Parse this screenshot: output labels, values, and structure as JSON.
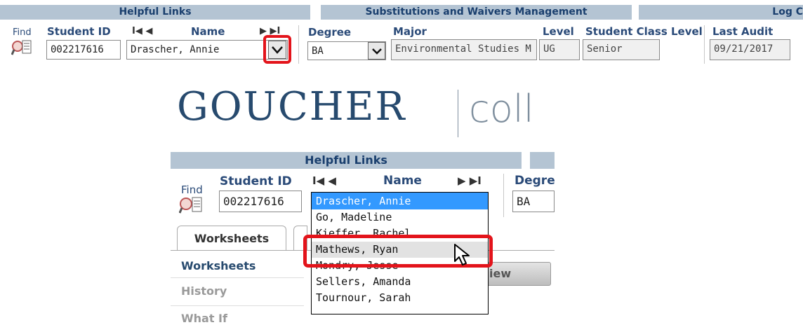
{
  "top": {
    "bands": [
      "Helpful Links",
      "Substitutions and Waivers Management",
      "Log C"
    ],
    "find_label": "Find",
    "labels": {
      "student_id": "Student ID",
      "name": "Name",
      "degree": "Degree",
      "major": "Major",
      "level": "Level",
      "class_level": "Student Class Level",
      "last_audit": "Last Audit"
    },
    "values": {
      "student_id": "002217616",
      "name": "Drascher, Annie",
      "degree": "BA",
      "major": "Environmental Studies M",
      "level": "UG",
      "class_level": "Senior",
      "last_audit": "09/21/2017"
    },
    "nav": {
      "first": "I◀ ◀",
      "next": "▶ ▶I"
    }
  },
  "logo": {
    "name": "GOUCHER",
    "suffix": "coll"
  },
  "zoom": {
    "band": "Helpful Links",
    "find_label": "Find",
    "labels": {
      "student_id": "Student ID",
      "name": "Name",
      "degree": "Degre"
    },
    "values": {
      "student_id": "002217616",
      "degree": "BA"
    },
    "nav": {
      "first": "I◀ ◀",
      "next": "▶ ▶I"
    },
    "tabs": [
      "Worksheets"
    ],
    "sidebar": [
      "Worksheets",
      "History",
      "What If"
    ],
    "view_button": "iew",
    "dropdown": {
      "options": [
        "Drascher, Annie",
        "Go, Madeline",
        "Kieffer, Rachel",
        "Mathews, Ryan",
        "Mondry, Jesse",
        "Sellers, Amanda",
        "Tournour, Sarah"
      ],
      "selected_index": 0,
      "hover_index": 3
    }
  },
  "colors": {
    "accent": "#2a4a78",
    "band": "#b4c4d3",
    "highlight": "#e3141b",
    "selected": "#3399ff"
  }
}
